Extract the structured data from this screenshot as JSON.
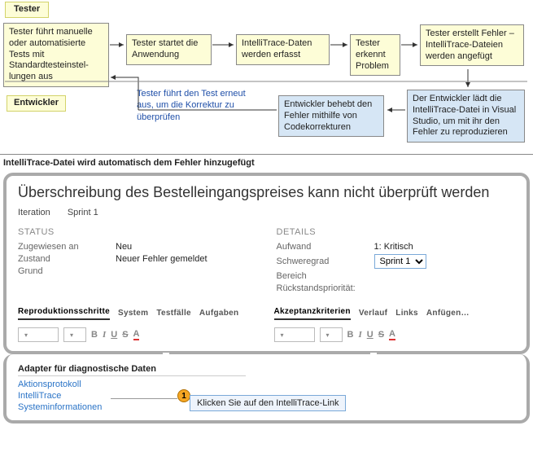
{
  "diagram": {
    "role_tester": "Tester",
    "role_dev": "Entwickler",
    "b1": "Tester führt manuelle oder automatisierte Tests mit Standardtesteinstel-lungen aus",
    "b2": "Tester startet die Anwendung",
    "b3": "IntelliTrace-Daten werden erfasst",
    "b4": "Tester erkennt Problem",
    "b5": "Tester erstellt Fehler – IntelliTrace-Dateien werden angefügt",
    "b6": "Der Entwickler lädt die IntelliTrace-Datei in Visual Studio, um mit ihr den Fehler zu reproduzieren",
    "b7": "Entwickler behebt den Fehler mithilfe von Codekorrekturen",
    "note": "Tester führt den Test erneut aus, um die Korrektur zu überprüfen"
  },
  "caption": "IntelliTrace-Datei wird automatisch dem Fehler hinzugefügt",
  "form": {
    "title": "Überschreibung des Bestelleingangspreises kann nicht überprüft werden",
    "iteration_lbl": "Iteration",
    "iteration_val": "Sprint 1",
    "status_hdr": "Status",
    "details_hdr": "Details",
    "assigned_lbl": "Zugewiesen an",
    "assigned_val": "Neu",
    "state_lbl": "Zustand",
    "state_val": "Neuer Fehler gemeldet",
    "reason_lbl": "Grund",
    "effort_lbl": "Aufwand",
    "effort_val": "1: Kritisch",
    "severity_lbl": "Schweregrad",
    "severity_val": "Sprint 1",
    "area_lbl": "Bereich",
    "backlog_lbl": "Rückstandspriorität:"
  },
  "tabs_left": [
    "Reproduktionsschritte",
    "System",
    "Testfälle",
    "Aufgaben"
  ],
  "tabs_right": [
    "Akzeptanzkriterien",
    "Verlauf",
    "Links",
    "Anfügen…"
  ],
  "diag": {
    "hdr": "Adapter für diagnostische Daten",
    "l1": "Aktionsprotokoll",
    "l2": "IntelliTrace",
    "l3": "Systeminformationen"
  },
  "callout": {
    "num": "1",
    "text": "Klicken Sie auf den IntelliTrace-Link"
  }
}
